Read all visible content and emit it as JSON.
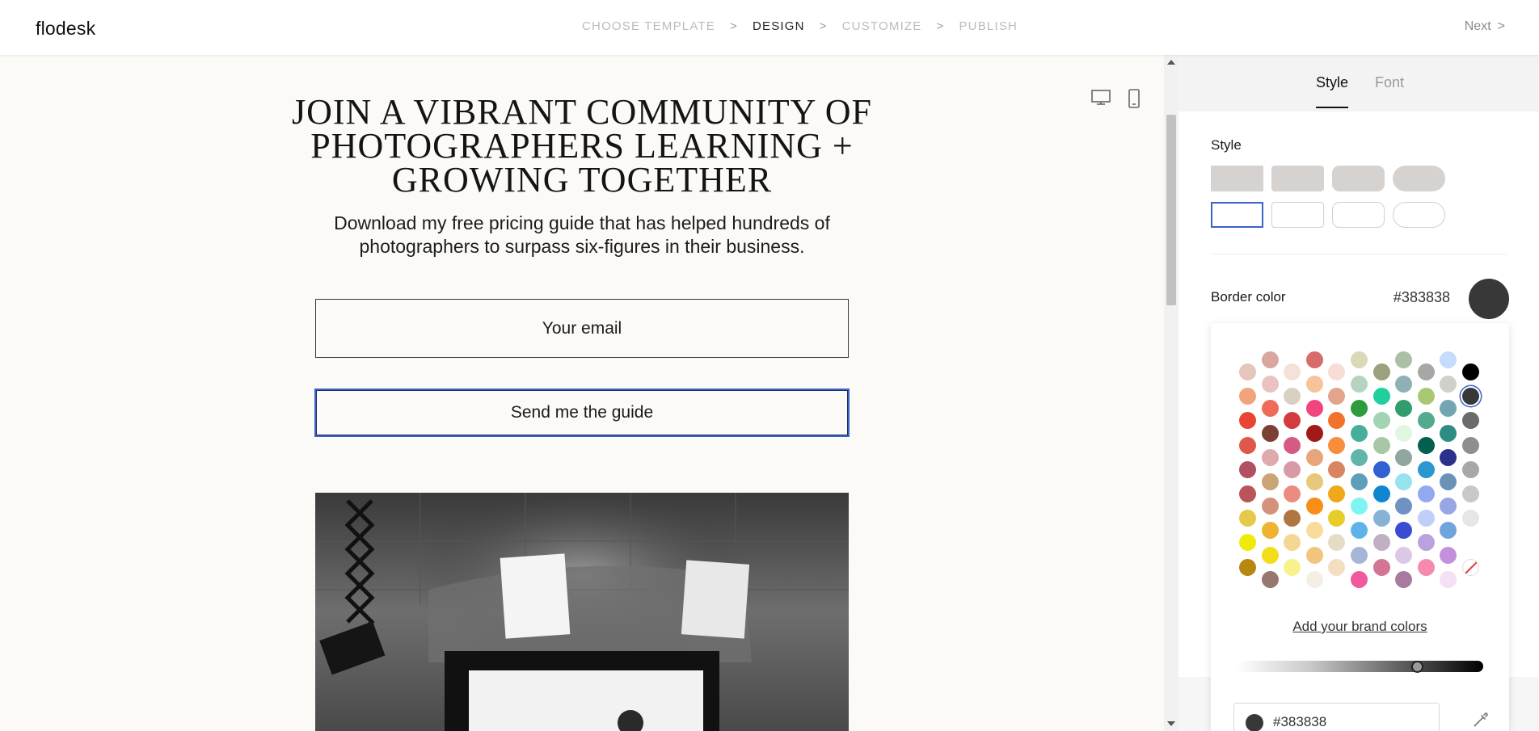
{
  "app": {
    "logo": "flodesk"
  },
  "steps": [
    {
      "label": "CHOOSE TEMPLATE",
      "active": false
    },
    {
      "label": "DESIGN",
      "active": true
    },
    {
      "label": "CUSTOMIZE",
      "active": false
    },
    {
      "label": "PUBLISH",
      "active": false
    }
  ],
  "step_separator": ">",
  "header": {
    "next_label": "Next",
    "next_arrow": ">"
  },
  "device_icons": [
    "desktop-icon",
    "mobile-icon"
  ],
  "form": {
    "headline": "JOIN A VIBRANT COMMUNITY OF PHOTOGRAPHERS LEARNING + GROWING TOGETHER",
    "subtext": "Download my free pricing guide that has helped hundreds of photographers to surpass six-figures in their business.",
    "email_placeholder": "Your email",
    "submit_label": "Send me the guide"
  },
  "panel": {
    "tabs": [
      {
        "label": "Style",
        "active": true
      },
      {
        "label": "Font",
        "active": false
      }
    ],
    "style_section_label": "Style",
    "style_swatches": {
      "filled": [
        "square",
        "slightly-rounded",
        "rounded",
        "pill"
      ],
      "outline": [
        "square",
        "slightly-rounded",
        "rounded",
        "pill"
      ],
      "selected": "outline-square"
    },
    "border_color": {
      "label": "Border color",
      "hex": "#383838",
      "value": "#383838"
    },
    "picker": {
      "selected_color": "#383838",
      "columns": [
        [
          "#e6c5bd",
          "#f3a37b",
          "#e94535",
          "#e0584a",
          "#b05060",
          "#b9545a",
          "#e6c94a",
          "#f0ea0a",
          "#b8870f"
        ],
        [
          "#daa79f",
          "#e9c3bf",
          "#ee6b58",
          "#7e3f33",
          "#dfaaad",
          "#c9a476",
          "#d4927a",
          "#eeb332",
          "#f1dd19",
          "#96786e"
        ],
        [
          "#f4e2d8",
          "#d8d0c1",
          "#d13c3e",
          "#d45c84",
          "#d89aa6",
          "#ec8c80",
          "#b07541",
          "#f5d794",
          "#f7f28e"
        ],
        [
          "#d86c6a",
          "#f6c39b",
          "#f14580",
          "#a21a17",
          "#e9a57a",
          "#e7c87a",
          "#f78e17",
          "#f7dc9c",
          "#f2c57e",
          "#f3efe3"
        ],
        [
          "#f7ddd5",
          "#e4a38b",
          "#f2722b",
          "#f98d3d",
          "#da8560",
          "#f1a71a",
          "#e8cd2a",
          "#e4dcc4",
          "#f4dec0"
        ],
        [
          "#d7d9b8",
          "#b6d3c0",
          "#2e9b3d",
          "#48ae9c",
          "#62b5a9",
          "#5d9fb9",
          "#7df6f2",
          "#5eb4ea",
          "#a5b5d6",
          "#f05a9d"
        ],
        [
          "#9aa17c",
          "#1fcf9c",
          "#a2d3b2",
          "#a7c7a7",
          "#2f61d3",
          "#0e86d2",
          "#87b2d6",
          "#c1b0c3",
          "#d37595"
        ],
        [
          "#abbfa6",
          "#8fb1b5",
          "#319c6c",
          "#e0f8e2",
          "#8fa7a0",
          "#95e3ed",
          "#6e92c3",
          "#3a4dd2",
          "#dcc7e6",
          "#a87aa0"
        ],
        [
          "#a8a7a5",
          "#a8c873",
          "#53ab8f",
          "#036050",
          "#2c96cf",
          "#92a8f2",
          "#c0cffa",
          "#b9a2de",
          "#f58aae"
        ],
        [
          "#c5dcfa",
          "#cfcfcc",
          "#74a6b1",
          "#2e8d83",
          "#2b328c",
          "#6c92b6",
          "#98a6e3",
          "#70a4dc",
          "#c490dd",
          "#f4dff5"
        ],
        [
          "#000000",
          "#383838",
          "#6b6b6b",
          "#8e8e8e",
          "#a8a8a8",
          "#c8c8c8",
          "#e6e6e6",
          "#ffffff",
          "none"
        ]
      ],
      "add_brand_colors_label": "Add your brand colors",
      "brightness_value": 0.73,
      "hex_input_value": "#383838"
    }
  }
}
